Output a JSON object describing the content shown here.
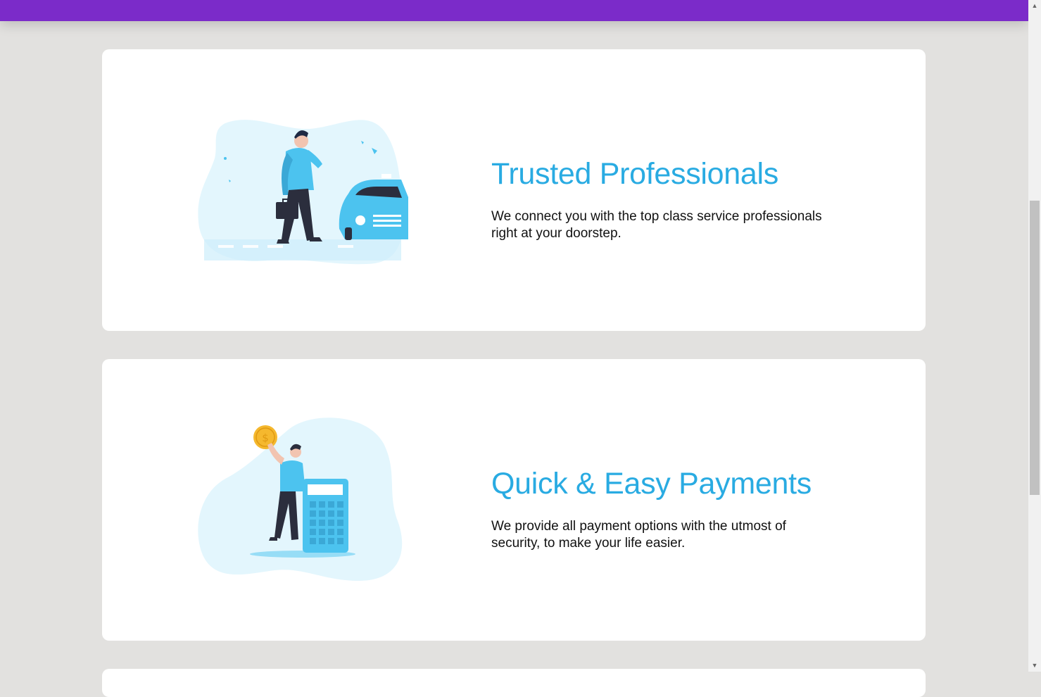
{
  "features": [
    {
      "title": "Trusted Professionals",
      "description": "We connect you with the top class service professionals right at your doorstep."
    },
    {
      "title": "Quick & Easy Payments",
      "description": "We provide all payment options with the utmost of security, to make your life easier."
    }
  ],
  "colors": {
    "header": "#7b2bc9",
    "title": "#29abe2",
    "background": "#e2e1df",
    "illustration_blob": "#e3f6fd",
    "illustration_accent": "#4cc3ef"
  },
  "icons": {
    "scroll_up": "chevron-up-icon",
    "scroll_down": "chevron-down-icon"
  }
}
